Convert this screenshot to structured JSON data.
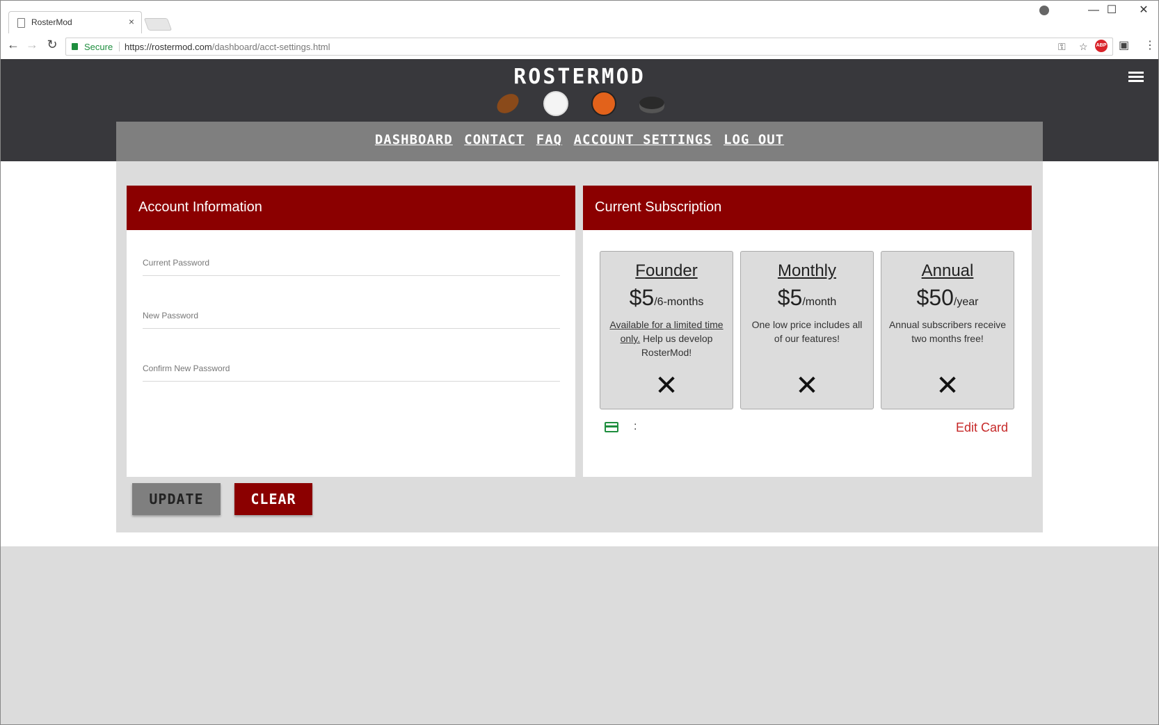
{
  "browser": {
    "tab_title": "RosterMod",
    "tab_close": "×",
    "secure_label": "Secure",
    "url_domain": "https://rostermod.com",
    "url_path": "/dashboard/acct-settings.html",
    "window_controls": {
      "minimize": "—",
      "maximize": "☐",
      "close": "✕"
    },
    "extension_abp": "ABP",
    "icons": [
      "back-icon",
      "forward-icon",
      "reload-icon",
      "lock-icon",
      "key-icon",
      "star-icon",
      "abp-icon",
      "cast-icon",
      "menu-dots-icon"
    ]
  },
  "site": {
    "logo": "ROSTERMOD",
    "sport_icons": [
      "football-icon",
      "baseball-icon",
      "basketball-icon",
      "hockey-puck-icon"
    ],
    "nav": [
      "DASHBOARD",
      "CONTACT",
      "FAQ",
      "ACCOUNT SETTINGS",
      "LOG OUT"
    ]
  },
  "account": {
    "title": "Account Information",
    "fields": [
      {
        "label": "Current Password",
        "value": ""
      },
      {
        "label": "New Password",
        "value": ""
      },
      {
        "label": "Confirm New Password",
        "value": ""
      }
    ],
    "buttons": {
      "update": "UPDATE",
      "clear": "CLEAR"
    }
  },
  "subscription": {
    "title": "Current Subscription",
    "plans": [
      {
        "name": "Founder",
        "price": "$5",
        "period": "/6-months",
        "desc_link": "Available for a limited time only.",
        "desc": " Help us develop RosterMod!",
        "status": "✕"
      },
      {
        "name": "Monthly",
        "price": "$5",
        "period": "/month",
        "desc_link": "",
        "desc": "One low price includes all of our features!",
        "status": "✕"
      },
      {
        "name": "Annual",
        "price": "$50",
        "period": "/year",
        "desc_link": "",
        "desc": "Annual subscribers receive two months free!",
        "status": "✕"
      }
    ],
    "card_separator": ":",
    "edit_card": "Edit Card"
  },
  "colors": {
    "header_dark": "#38383c",
    "nav_gray": "#7f7f7f",
    "brand_red": "#8b0000",
    "link_red": "#c62828",
    "secure_green": "#1e8e3e"
  }
}
